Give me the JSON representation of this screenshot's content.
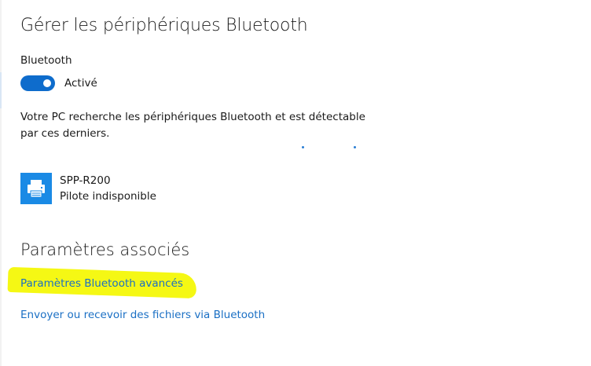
{
  "page": {
    "title": "Gérer les périphériques Bluetooth"
  },
  "bluetooth": {
    "label": "Bluetooth",
    "toggle_on": true,
    "toggle_state_label": "Activé",
    "status_text": "Votre PC recherche les périphériques Bluetooth et est détectable par ces derniers."
  },
  "devices": [
    {
      "name": "SPP-R200",
      "status": "Pilote indisponible",
      "icon": "printer-icon"
    }
  ],
  "related": {
    "title": "Paramètres associés",
    "links": [
      {
        "label": "Paramètres Bluetooth avancés",
        "highlighted": true
      },
      {
        "label": "Envoyer ou recevoir des fichiers via Bluetooth",
        "highlighted": false
      }
    ]
  },
  "colors": {
    "accent": "#0e6ccc",
    "link": "#1a6fc4",
    "device_tile": "#1a8ae5",
    "highlight": "#f4f700"
  }
}
